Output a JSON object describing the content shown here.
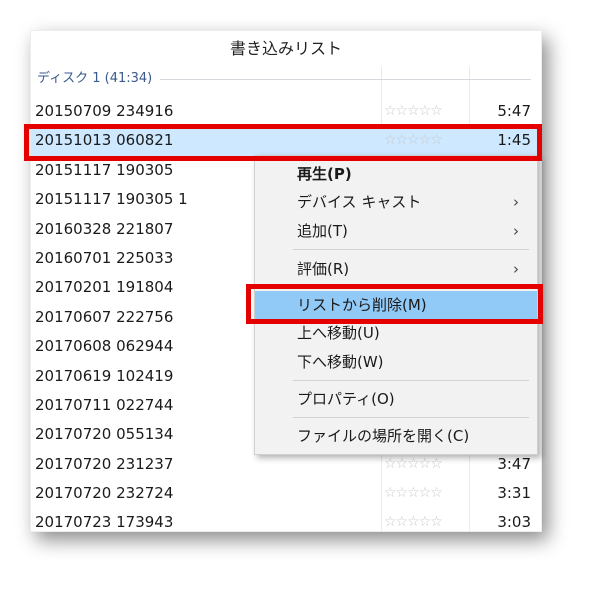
{
  "list": {
    "title": "書き込みリスト",
    "group_label": "ディスク 1 (41:34)",
    "rows": [
      {
        "name": "20150709 234916",
        "stars": "☆☆☆☆☆",
        "time": "5:47"
      },
      {
        "name": "20151013 060821",
        "stars": "☆☆☆☆☆",
        "time": "1:45"
      },
      {
        "name": "20151117 190305",
        "stars": "",
        "time": ""
      },
      {
        "name": "20151117 190305 1",
        "stars": "",
        "time": ""
      },
      {
        "name": "20160328 221807",
        "stars": "",
        "time": ""
      },
      {
        "name": "20160701 225033",
        "stars": "",
        "time": ""
      },
      {
        "name": "20170201 191804",
        "stars": "",
        "time": ""
      },
      {
        "name": "20170607 222756",
        "stars": "",
        "time": ""
      },
      {
        "name": "20170608 062944",
        "stars": "",
        "time": ""
      },
      {
        "name": "20170619 102419",
        "stars": "",
        "time": ""
      },
      {
        "name": "20170711 022744",
        "stars": "",
        "time": ""
      },
      {
        "name": "20170720 055134",
        "stars": "",
        "time": ""
      },
      {
        "name": "20170720 231237",
        "stars": "☆☆☆☆☆",
        "time": "3:47"
      },
      {
        "name": "20170720 232724",
        "stars": "☆☆☆☆☆",
        "time": "3:31"
      },
      {
        "name": "20170723 173943",
        "stars": "☆☆☆☆☆",
        "time": "3:03"
      }
    ]
  },
  "context_menu": {
    "play": "再生(P)",
    "cast": "デバイス キャスト",
    "add": "追加(T)",
    "rate": "評価(R)",
    "remove": "リストから削除(M)",
    "move_up": "上へ移動(U)",
    "move_down": "下へ移動(W)",
    "properties": "プロパティ(O)",
    "open_location": "ファイルの場所を開く(C)",
    "submenu_arrow": "›"
  },
  "colors": {
    "selection": "#cde8ff",
    "menu_highlight": "#91c9f7",
    "annotation": "#e50000"
  }
}
